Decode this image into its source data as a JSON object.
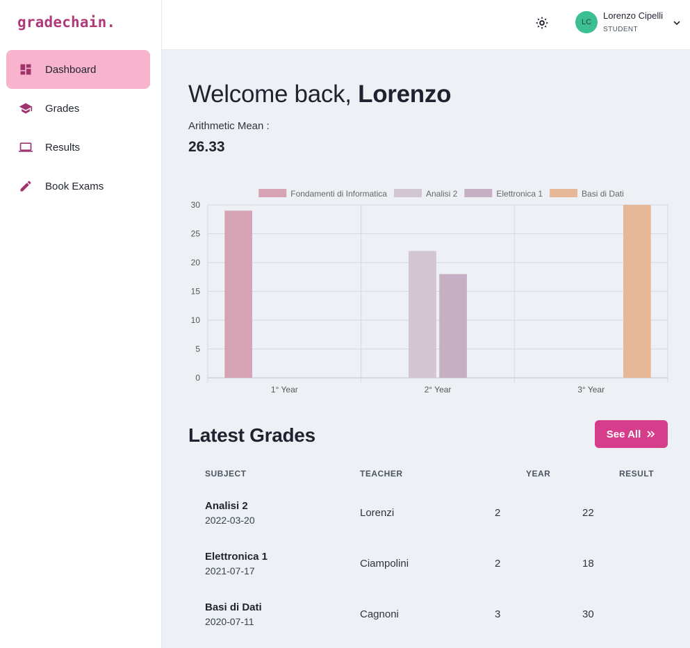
{
  "app": {
    "logo": "gradechain."
  },
  "sidebar": {
    "items": [
      {
        "label": "Dashboard",
        "icon": "dashboard-icon",
        "active": true
      },
      {
        "label": "Grades",
        "icon": "graduation-cap-icon",
        "active": false
      },
      {
        "label": "Results",
        "icon": "laptop-icon",
        "active": false
      },
      {
        "label": "Book Exams",
        "icon": "pencil-icon",
        "active": false
      }
    ]
  },
  "header": {
    "avatar_initials": "LC",
    "user_name": "Lorenzo Cipelli",
    "user_role": "STUDENT",
    "theme_icon": "sun-icon",
    "menu_icon": "chevron-down-icon"
  },
  "main": {
    "welcome_prefix": "Welcome back, ",
    "welcome_name": "Lorenzo",
    "mean_label": "Arithmetic Mean :",
    "mean_value": "26.33",
    "latest_title": "Latest Grades",
    "see_all_label": "See All"
  },
  "chart_data": {
    "type": "bar",
    "categories": [
      "1° Year",
      "2° Year",
      "3° Year"
    ],
    "series": [
      {
        "name": "Fondamenti di Informatica",
        "color": "#d6a3b4",
        "values": [
          29,
          null,
          null
        ]
      },
      {
        "name": "Analisi 2",
        "color": "#d2c6d3",
        "values": [
          null,
          22,
          null
        ]
      },
      {
        "name": "Elettronica 1",
        "color": "#c5afc3",
        "values": [
          null,
          18,
          null
        ]
      },
      {
        "name": "Basi di Dati",
        "color": "#e6b897",
        "values": [
          null,
          null,
          30
        ]
      }
    ],
    "yticks": [
      0,
      5,
      10,
      15,
      20,
      25,
      30
    ],
    "ylim": [
      0,
      30
    ],
    "grid": true,
    "legend": "top"
  },
  "table": {
    "headers": {
      "subject": "SUBJECT",
      "teacher": "TEACHER",
      "year": "YEAR",
      "result": "RESULT"
    },
    "rows": [
      {
        "subject": "Analisi 2",
        "date": "2022-03-20",
        "teacher": "Lorenzi",
        "year": "2",
        "result": "22"
      },
      {
        "subject": "Elettronica 1",
        "date": "2021-07-17",
        "teacher": "Ciampolini",
        "year": "2",
        "result": "18"
      },
      {
        "subject": "Basi di Dati",
        "date": "2020-07-11",
        "teacher": "Cagnoni",
        "year": "3",
        "result": "30"
      }
    ]
  }
}
